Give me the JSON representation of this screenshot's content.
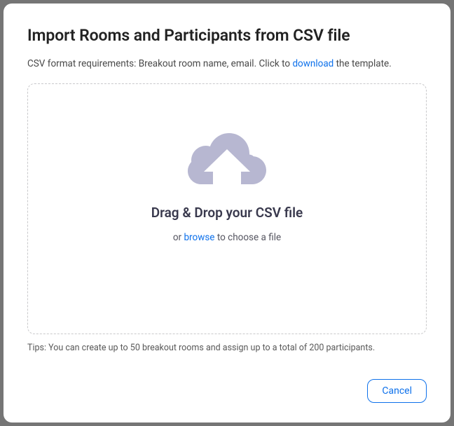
{
  "modal": {
    "title": "Import Rooms and Participants from CSV file",
    "instructions_prefix": "CSV format requirements: Breakout room name, email. Click to ",
    "instructions_link": "download",
    "instructions_suffix": " the template.",
    "dropzone": {
      "main_text": "Drag & Drop your CSV file",
      "sub_prefix": "or ",
      "sub_link": "browse",
      "sub_suffix": " to choose a file"
    },
    "tips": "Tips: You can create up to 50 breakout rooms and assign up to a total of 200 participants.",
    "footer": {
      "cancel_label": "Cancel"
    }
  },
  "colors": {
    "link": "#0e71eb",
    "icon": "#b7b7d1"
  }
}
